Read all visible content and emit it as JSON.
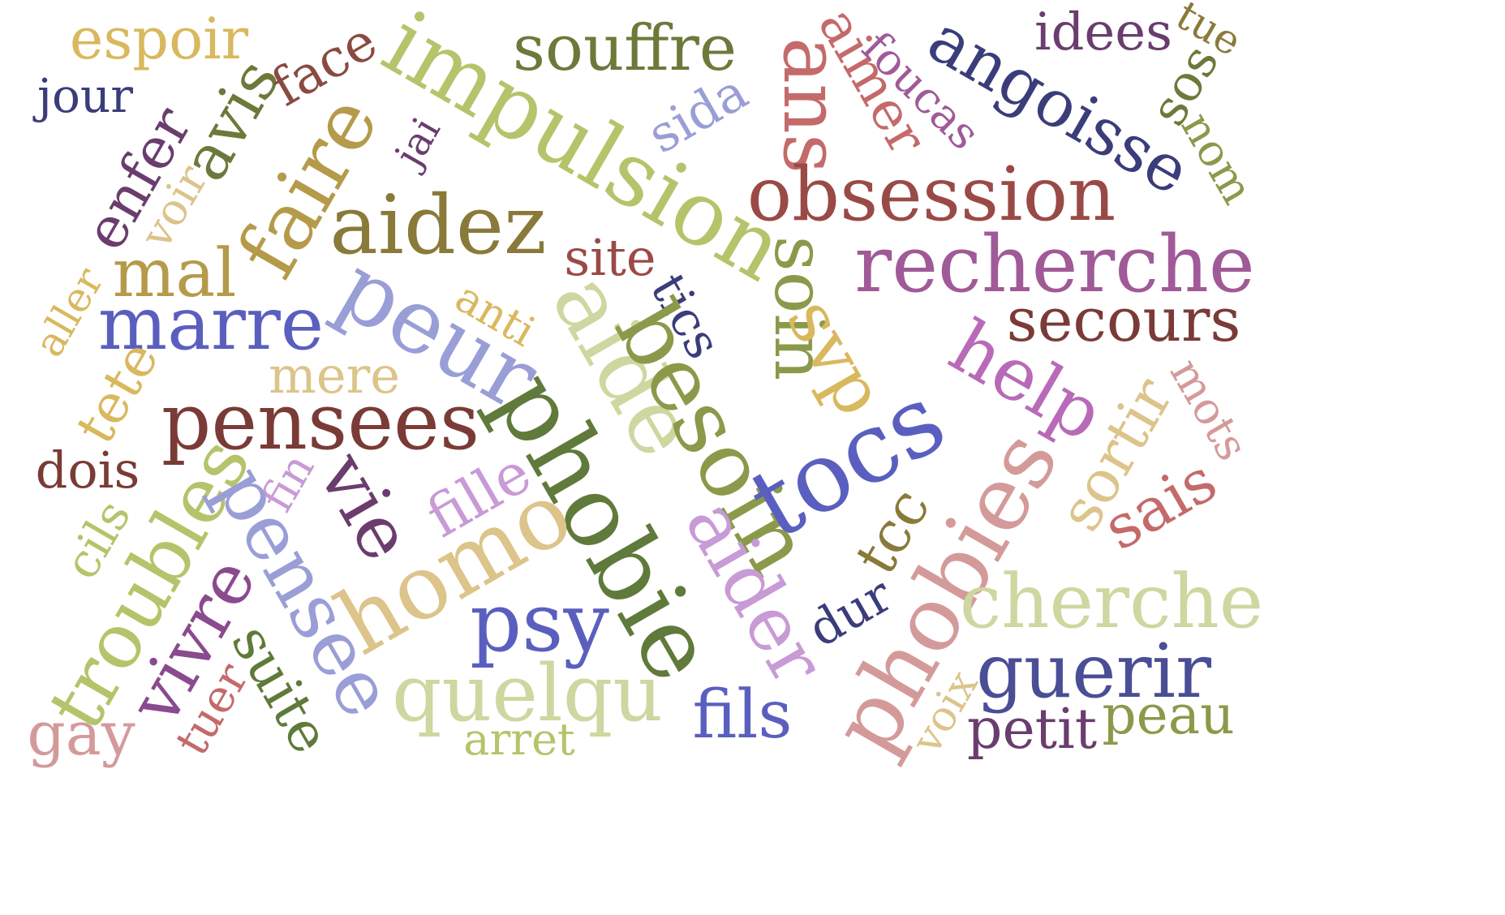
{
  "colors": {
    "gold": "#d9b85e",
    "navy": "#3a3d7a",
    "maroon": "#7a3b36",
    "lime": "#b5c46a",
    "olive": "#6b7a3a",
    "brown": "#8a7a3a",
    "purple": "#6a3d6e",
    "periwinkle": "#9a9ed6",
    "blue": "#5a5fbf",
    "rose": "#c46a6a",
    "mauve": "#a05a98",
    "pink": "#d49a9a",
    "lavender": "#c89ad6",
    "beige": "#dcc48a",
    "sage": "#cfd6a0",
    "khaki": "#b59a4a",
    "crimson": "#a04040"
  },
  "words": [
    "espoir",
    "jour",
    "avis",
    "face",
    "enfer",
    "impulsion",
    "souffre",
    "aimer",
    "foucas",
    "angoisse",
    "idees",
    "tue",
    "sos",
    "nom",
    "ans",
    "sida",
    "jai",
    "obsession",
    "faire",
    "aidez",
    "voir",
    "mal",
    "site",
    "recherche",
    "aller",
    "marre",
    "peur",
    "anti",
    "tics",
    "soin",
    "svp",
    "secours",
    "help",
    "mere",
    "tete",
    "pensees",
    "aide",
    "mots",
    "sortir",
    "dois",
    "phobie",
    "besoin",
    "tocs",
    "fille",
    "fin",
    "vie",
    "cils",
    "troubles",
    "pensee",
    "homo",
    "sais",
    "phobies",
    "tcc",
    "aider",
    "cherche",
    "psy",
    "dur",
    "guerir",
    "vivre",
    "suite",
    "quelqu",
    "fils",
    "voix",
    "tuer",
    "gay",
    "arret",
    "petit",
    "peau"
  ]
}
